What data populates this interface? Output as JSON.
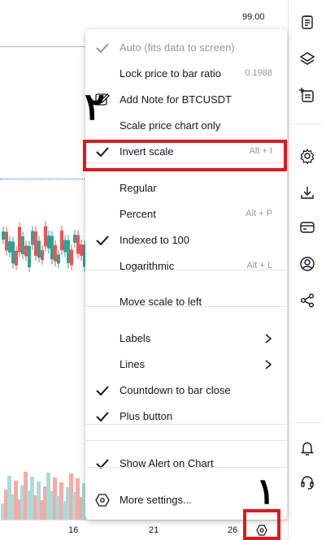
{
  "chart": {
    "price_top": "99.00",
    "time_labels": [
      "16",
      "21",
      "26"
    ]
  },
  "menu": {
    "items": [
      {
        "label": "Auto (fits data to screen)",
        "checked": true,
        "disabled": true,
        "shortcut": ""
      },
      {
        "label": "Lock price to bar ratio",
        "checked": false,
        "disabled": false,
        "shortcut": "0.1988"
      },
      {
        "label": "Add Note for BTCUSDT",
        "checked": false,
        "disabled": false,
        "shortcut": "",
        "icon": "note-edit-icon"
      },
      {
        "label": "Scale price chart only",
        "checked": false,
        "disabled": false,
        "shortcut": ""
      },
      {
        "label": "Invert scale",
        "checked": true,
        "disabled": false,
        "shortcut": "Alt + I"
      },
      {
        "label": "Regular",
        "checked": false,
        "disabled": false,
        "shortcut": ""
      },
      {
        "label": "Percent",
        "checked": false,
        "disabled": false,
        "shortcut": "Alt + P"
      },
      {
        "label": "Indexed to 100",
        "checked": true,
        "disabled": false,
        "shortcut": ""
      },
      {
        "label": "Logarithmic",
        "checked": false,
        "disabled": false,
        "shortcut": "Alt + L"
      },
      {
        "label": "Move scale to left",
        "checked": false,
        "disabled": false,
        "shortcut": ""
      },
      {
        "label": "Labels",
        "checked": false,
        "disabled": false,
        "submenu": true
      },
      {
        "label": "Lines",
        "checked": false,
        "disabled": false,
        "submenu": true
      },
      {
        "label": "Countdown to bar close",
        "checked": true,
        "disabled": false,
        "shortcut": ""
      },
      {
        "label": "Plus button",
        "checked": true,
        "disabled": false,
        "shortcut": ""
      },
      {
        "label": "Show Alert on Chart",
        "checked": true,
        "disabled": false,
        "shortcut": ""
      },
      {
        "label": "More settings...",
        "checked": false,
        "disabled": false,
        "shortcut": "",
        "icon": "settings-hex-icon"
      }
    ]
  },
  "annotations": {
    "step_1": "١",
    "step_2": "٢",
    "box_color": "#e3161b"
  },
  "colors": {
    "up": "#26a69a",
    "down": "#ef5350",
    "text": "#131722",
    "muted": "#9598a1"
  },
  "toolbar_icons": [
    "watchlist-icon",
    "layers-icon",
    "add-note-icon",
    "settings-gear-icon",
    "download-icon",
    "card-icon",
    "user-icon",
    "share-icon",
    "alert-bell-icon",
    "support-headset-icon"
  ]
}
